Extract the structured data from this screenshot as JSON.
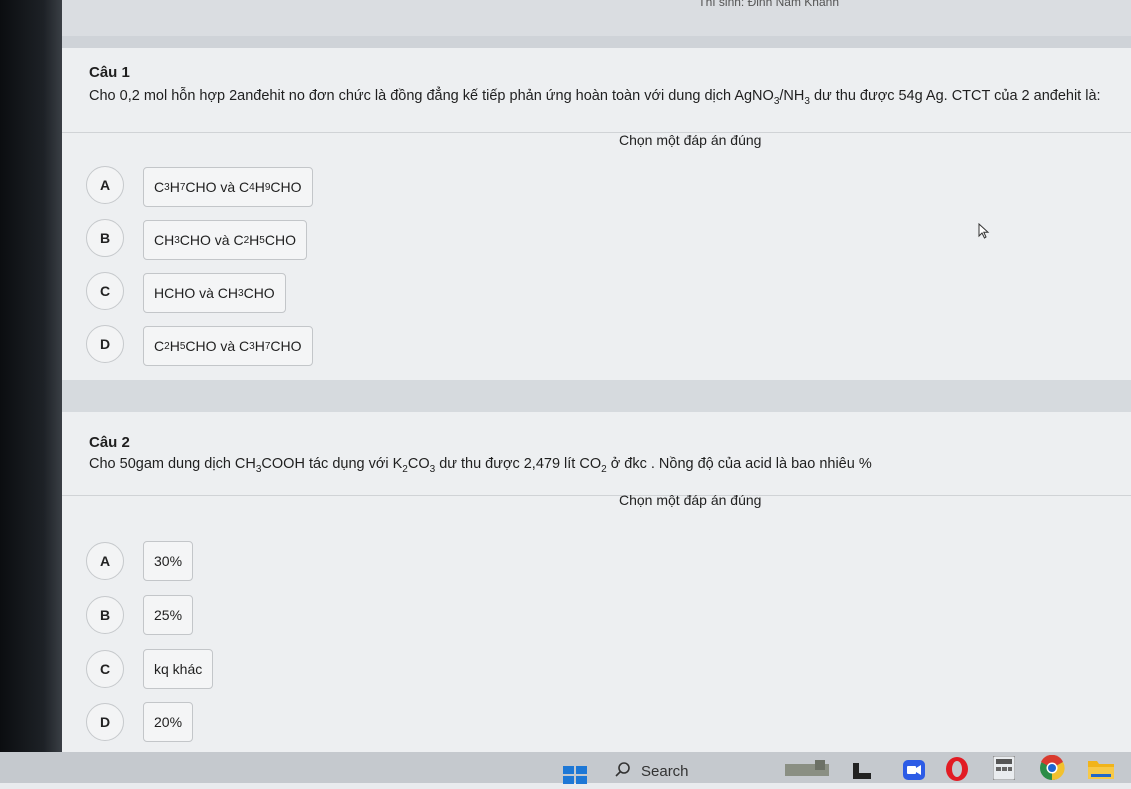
{
  "header": {
    "student_label": "Thí sinh: Đinh Nam Khánh"
  },
  "q1": {
    "title": "Câu 1",
    "text": {
      "part1": "Cho 0,2 mol hỗn hợp 2anđehit no đơn chức là đồng đẳng kế tiếp phản ứng hoàn toàn với dung dịch AgNO",
      "sub1": "3",
      "part2": "/NH",
      "sub2": "3",
      "part3": " dư thu được 54g Ag. CTCT của 2 anđehit là:"
    },
    "hint": "Chọn một đáp án đúng",
    "options": [
      {
        "letter": "A",
        "segments": [
          [
            "C",
            ""
          ],
          [
            "3",
            true
          ],
          [
            "H",
            ""
          ],
          [
            "7",
            true
          ],
          [
            "CHO và C",
            ""
          ],
          [
            "4",
            true
          ],
          [
            "H",
            ""
          ],
          [
            "9",
            true
          ],
          [
            "CHO",
            ""
          ]
        ]
      },
      {
        "letter": "B",
        "segments": [
          [
            "CH",
            ""
          ],
          [
            "3",
            true
          ],
          [
            "CHO và C",
            ""
          ],
          [
            "2",
            true
          ],
          [
            "H",
            ""
          ],
          [
            "5",
            true
          ],
          [
            "CHO",
            ""
          ]
        ]
      },
      {
        "letter": "C",
        "segments": [
          [
            "HCHO và CH",
            ""
          ],
          [
            "3",
            true
          ],
          [
            "CHO",
            ""
          ]
        ]
      },
      {
        "letter": "D",
        "segments": [
          [
            "C",
            ""
          ],
          [
            "2",
            true
          ],
          [
            "H",
            ""
          ],
          [
            "5",
            true
          ],
          [
            "CHO và C",
            ""
          ],
          [
            "3",
            true
          ],
          [
            "H",
            ""
          ],
          [
            "7",
            true
          ],
          [
            "CHO",
            ""
          ]
        ]
      }
    ]
  },
  "q2": {
    "title": "Câu 2",
    "text": {
      "part1": "Cho 50gam dung dịch CH",
      "sub1": "3",
      "part2": "COOH tác dụng với K",
      "sub2": "2",
      "part3": "CO",
      "sub3": "3",
      "part4": " dư thu được 2,479 lít CO",
      "sub4": "2",
      "part5": " ở đkc . Nồng độ của acid là bao nhiêu %"
    },
    "hint": "Chọn một đáp án đúng",
    "options": [
      {
        "letter": "A",
        "label": "30%"
      },
      {
        "letter": "B",
        "label": "25%"
      },
      {
        "letter": "C",
        "label": "kq khác"
      },
      {
        "letter": "D",
        "label": "20%"
      }
    ]
  },
  "taskbar": {
    "search_label": "Search",
    "icons": [
      "start-icon",
      "search-icon",
      "widgets-icon",
      "file-explorer-icon",
      "zoom-icon",
      "opera-icon",
      "calculator-icon",
      "chrome-icon",
      "folder-icon"
    ]
  },
  "colors": {
    "background": "#e9ebee",
    "band": "#cfd3d8",
    "option_border": "#c3c6c9"
  }
}
